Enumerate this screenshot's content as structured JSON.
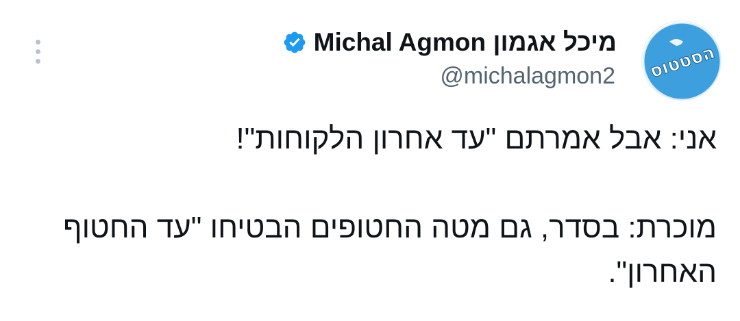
{
  "author": {
    "display_name": "מיכל אגמון Michal Agmon",
    "handle": "@michalagmon2",
    "avatar_text": "הסטטוס",
    "verified_icon": "verified-badge-icon",
    "accent": "#1d9bf0"
  },
  "more_icon": "more-vertical-icon",
  "tweet": {
    "line1": "אני: אבל אמרתם \"עד אחרון הלקוחות\"!",
    "line2": "מוכרת: בסדר, גם מטה החטופים הבטיחו \"עד החטוף האחרון\"."
  }
}
